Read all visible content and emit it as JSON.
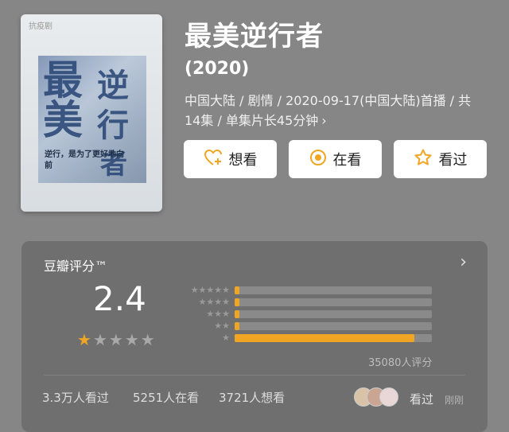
{
  "movie": {
    "title": "最美逆行者",
    "year": "(2020)",
    "meta_line1": "中国大陆 / 剧情 / 2020-09-17(中国大陆)首播 / 共",
    "meta_line2": "14集 / 单集片长45分钟",
    "poster": {
      "top_tag": "抗疫剧",
      "chars": [
        "最",
        "美",
        "逆",
        "行",
        "者"
      ],
      "slogan": "逆行，是为了更好地向前"
    }
  },
  "actions": {
    "want": {
      "label": "想看",
      "icon": "heart-plus-icon"
    },
    "watching": {
      "label": "在看",
      "icon": "target-icon"
    },
    "watched": {
      "label": "看过",
      "icon": "star-outline-icon"
    }
  },
  "rating": {
    "title": "豆瓣评分™",
    "score": "2.4",
    "stars_filled": 1,
    "stars_total": 5,
    "histogram": [
      {
        "stars": 5,
        "fraction": 0.02
      },
      {
        "stars": 4,
        "fraction": 0.01
      },
      {
        "stars": 3,
        "fraction": 0.01
      },
      {
        "stars": 2,
        "fraction": 0.02
      },
      {
        "stars": 1,
        "fraction": 0.91
      }
    ],
    "count_label": "35080人评分",
    "colors": {
      "accent": "#f0a623",
      "track": "#8a8a8a"
    }
  },
  "stats": {
    "watched": "3.3万人看过",
    "watching": "5251人在看",
    "want": "3721人想看",
    "recent_label": "看过",
    "recent_time": "刚刚"
  }
}
